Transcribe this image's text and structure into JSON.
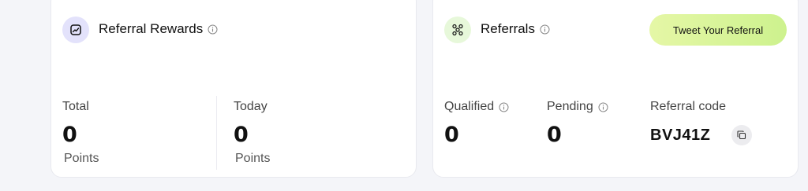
{
  "rewards": {
    "title": "Referral Rewards",
    "icon": "trend-chart-icon",
    "total": {
      "label": "Total",
      "value": "0",
      "unit": "Points"
    },
    "today": {
      "label": "Today",
      "value": "0",
      "unit": "Points"
    }
  },
  "referrals": {
    "title": "Referrals",
    "icon": "network-nodes-icon",
    "tweet_button": "Tweet Your Referral",
    "qualified": {
      "label": "Qualified",
      "value": "0"
    },
    "pending": {
      "label": "Pending",
      "value": "0"
    },
    "code": {
      "label": "Referral code",
      "value": "BVJ41Z"
    }
  },
  "colors": {
    "rewards_icon_bg": "#e3e2fb",
    "referrals_icon_bg": "#e7f8da",
    "tweet_button_bg": "#d8f49a"
  }
}
